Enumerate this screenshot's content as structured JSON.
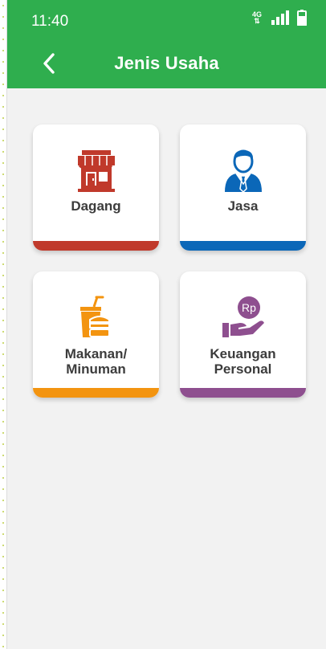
{
  "status_bar": {
    "time": "11:40",
    "network": "4G"
  },
  "header": {
    "title": "Jenis Usaha",
    "back_icon": "chevron-left-icon"
  },
  "categories": [
    {
      "label": "Dagang",
      "icon": "store-icon",
      "color": "#c0392b"
    },
    {
      "label": "Jasa",
      "icon": "person-icon",
      "color": "#0b67b8"
    },
    {
      "label_line1": "Makanan/",
      "label_line2": "Minuman",
      "icon": "food-drink-icon",
      "color": "#f39410"
    },
    {
      "label_line1": "Keuangan",
      "label_line2": "Personal",
      "icon": "money-hand-icon",
      "icon_text": "Rp",
      "color": "#8e4f8f"
    }
  ]
}
